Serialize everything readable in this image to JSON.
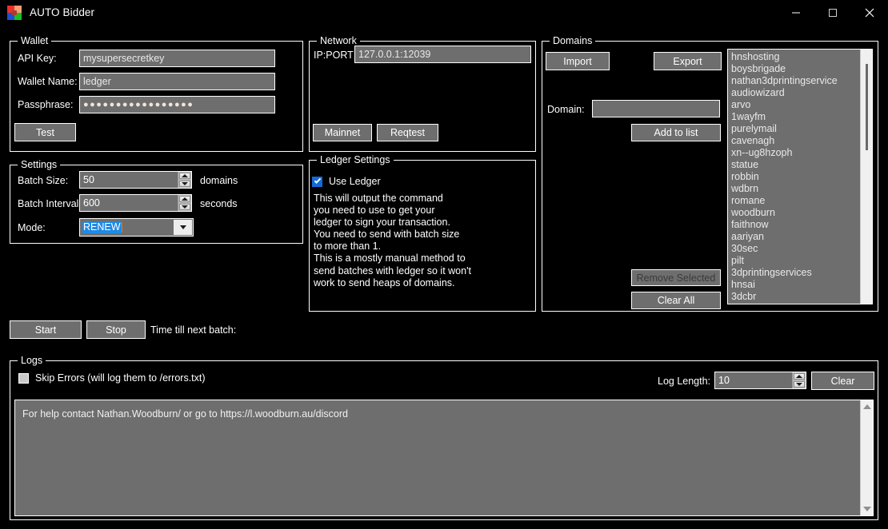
{
  "window": {
    "title": "AUTO Bidder",
    "icon": "app-logo-icon",
    "minimize": "—",
    "maximize": "□",
    "close": "✕"
  },
  "wallet": {
    "legend": "Wallet",
    "api_key_label": "API Key:",
    "api_key_value": "mysupersecretkey",
    "wallet_name_label": "Wallet Name:",
    "wallet_name_value": "ledger",
    "passphrase_label": "Passphrase:",
    "passphrase_masked": "●●●●●●●●●●●●●●●●●",
    "test_button": "Test"
  },
  "network": {
    "legend": "Network",
    "ipport_label": "IP:PORT",
    "ipport_value": "127.0.0.1:12039",
    "mainnet_button": "Mainnet",
    "reqtest_button": "Reqtest"
  },
  "settings": {
    "legend": "Settings",
    "batch_size_label": "Batch Size:",
    "batch_size_value": "50",
    "batch_size_unit": "domains",
    "batch_interval_label": "Batch Interval:",
    "batch_interval_value": "600",
    "batch_interval_unit": "seconds",
    "mode_label": "Mode:",
    "mode_value": "RENEW"
  },
  "ledger_settings": {
    "legend": "Ledger Settings",
    "use_ledger_label": "Use Ledger",
    "use_ledger_checked": true,
    "description": "This will output the command\nyou need to use to get your\nledger to sign your transaction.\nYou need to send with batch size\nto more than 1.\nThis is a mostly manual method to\nsend batches with ledger so it won't\nwork to send heaps of domains."
  },
  "domains": {
    "legend": "Domains",
    "import_button": "Import",
    "export_button": "Export",
    "domain_label": "Domain:",
    "domain_input_value": "",
    "add_to_list_button": "Add to list",
    "remove_selected_button": "Remove Selected",
    "remove_selected_disabled": true,
    "clear_all_button": "Clear All",
    "list": [
      "hnshosting",
      "boysbrigade",
      "nathan3dprintingservice",
      "audiowizard",
      "arvo",
      "1wayfm",
      "purelymail",
      "cavenagh",
      "xn--ug8hzoph",
      "statue",
      "robbin",
      "wdbrn",
      "romane",
      "woodburn",
      "faithnow",
      "aariyan",
      "30sec",
      "pilt",
      "3dprintingservices",
      "hnsai",
      "3dcbr"
    ]
  },
  "controls": {
    "start_button": "Start",
    "stop_button": "Stop",
    "time_till_next_batch_label": "Time till next batch:",
    "time_till_next_batch_value": ""
  },
  "logs": {
    "legend": "Logs",
    "skip_errors_label": "Skip Errors (will log them to /errors.txt)",
    "skip_errors_checked": false,
    "log_length_label": "Log Length:",
    "log_length_value": "10",
    "clear_button": "Clear",
    "log_text": "For help contact Nathan.Woodburn/ or go to https://l.woodburn.au/discord"
  },
  "colors": {
    "background": "#000000",
    "field": "#6e6e6e",
    "accent_blue": "#1e8ae6",
    "checkbox_blue": "#1669d6",
    "border": "#ffffff"
  }
}
